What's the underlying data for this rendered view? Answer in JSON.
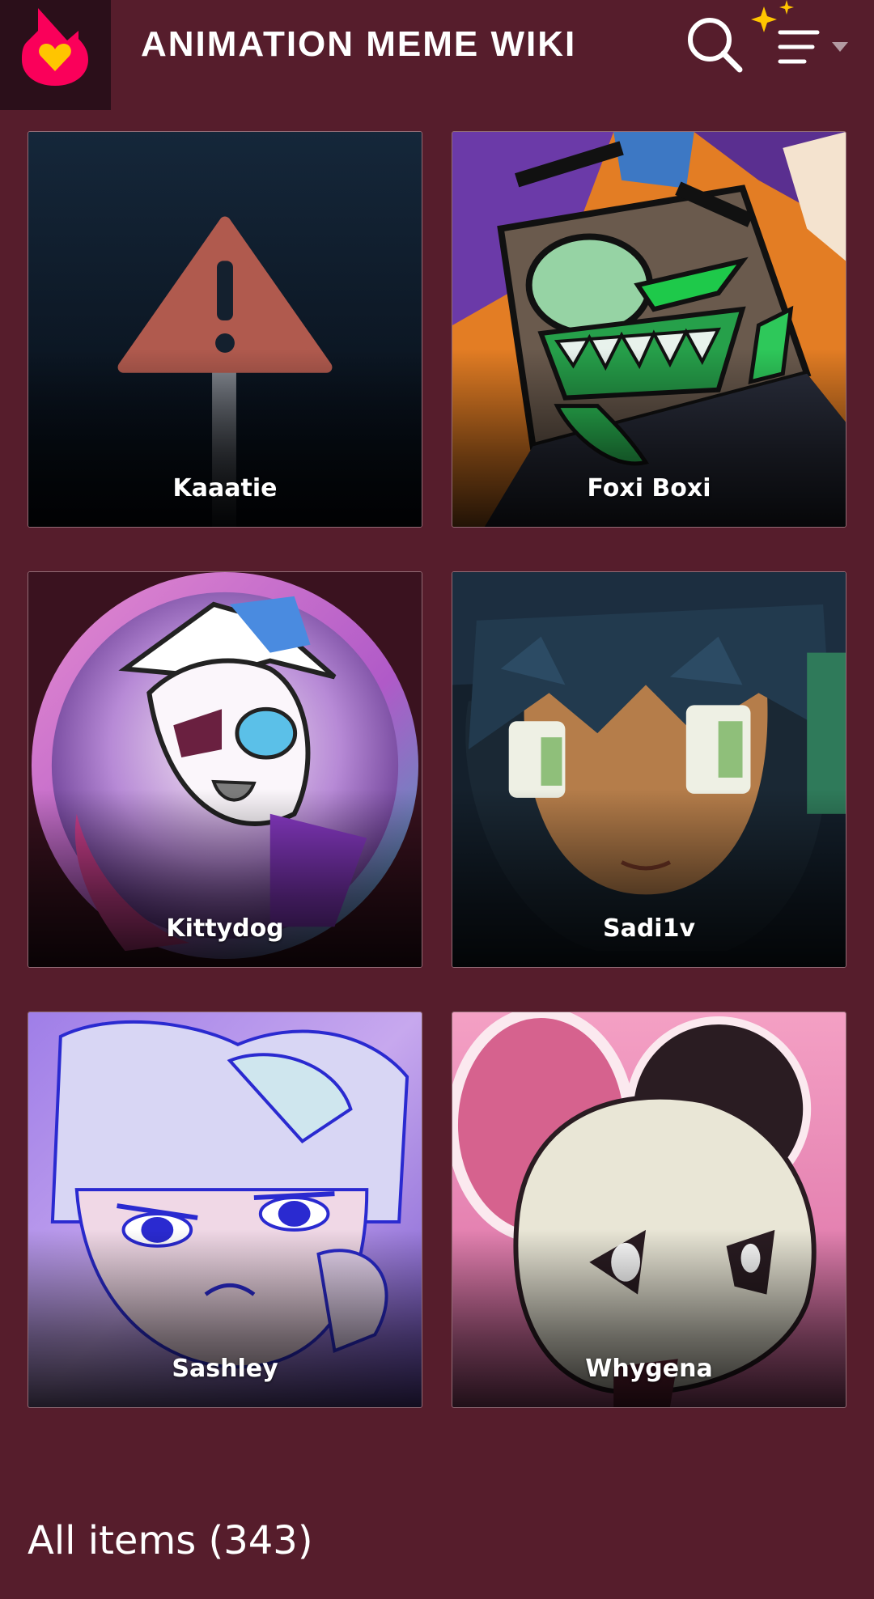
{
  "header": {
    "wiki_title": "ANIMATION MEME WIKI",
    "logo_icon": "fandom-heart-logo-icon",
    "search_icon": "search-icon",
    "menu_icon": "menu-sparkle-icon",
    "accent": "#fa005a",
    "background": "#561d2c"
  },
  "cards": [
    {
      "label": "Kaaatie",
      "image": "warning-placeholder"
    },
    {
      "label": "Foxi Boxi",
      "image": "character-art"
    },
    {
      "label": "Kittydog",
      "image": "character-art"
    },
    {
      "label": "Sadi1v",
      "image": "character-art"
    },
    {
      "label": "Sashley",
      "image": "character-art"
    },
    {
      "label": "Whygena",
      "image": "character-art"
    }
  ],
  "all_items": {
    "label": "All items (343)"
  }
}
